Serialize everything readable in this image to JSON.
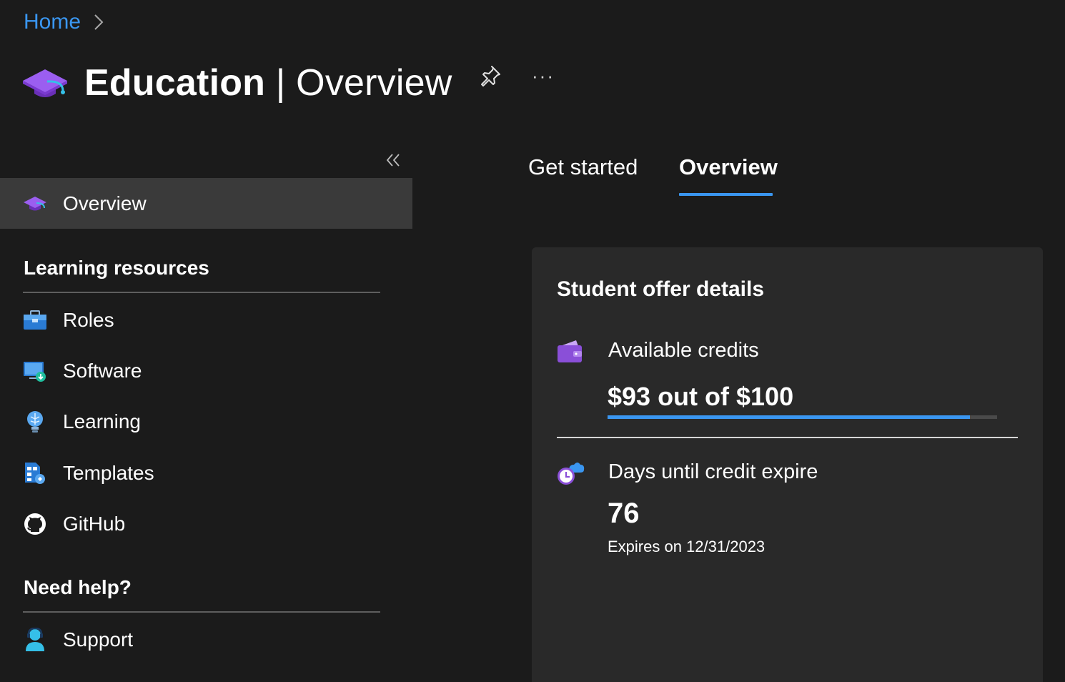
{
  "breadcrumb": {
    "home": "Home"
  },
  "header": {
    "title_strong": "Education",
    "title_separator": " | ",
    "title_rest": "Overview",
    "more_label": "···"
  },
  "sidebar": {
    "active_item": {
      "label": "Overview",
      "icon": "graduation-cap-icon"
    },
    "sections": [
      {
        "title": "Learning resources",
        "items": [
          {
            "label": "Roles",
            "icon": "toolbox-icon"
          },
          {
            "label": "Software",
            "icon": "monitor-download-icon"
          },
          {
            "label": "Learning",
            "icon": "lightbulb-icon"
          },
          {
            "label": "Templates",
            "icon": "template-icon"
          },
          {
            "label": "GitHub",
            "icon": "github-icon"
          }
        ]
      },
      {
        "title": "Need help?",
        "items": [
          {
            "label": "Support",
            "icon": "person-support-icon"
          }
        ]
      }
    ]
  },
  "tabs": [
    {
      "label": "Get started",
      "active": false
    },
    {
      "label": "Overview",
      "active": true
    }
  ],
  "card": {
    "title": "Student offer details",
    "credits": {
      "label": "Available credits",
      "value_text": "$93 out of $100",
      "used_fraction": 0.93,
      "icon": "wallet-icon"
    },
    "expiry": {
      "label": "Days until credit expire",
      "days": "76",
      "expires_text": "Expires on 12/31/2023",
      "icon": "cloud-clock-icon"
    }
  },
  "colors": {
    "background": "#1b1b1b",
    "card": "#292929",
    "accent": "#3a96f0",
    "active_nav": "#3a3a3a",
    "purple": "#8a4fd8"
  }
}
